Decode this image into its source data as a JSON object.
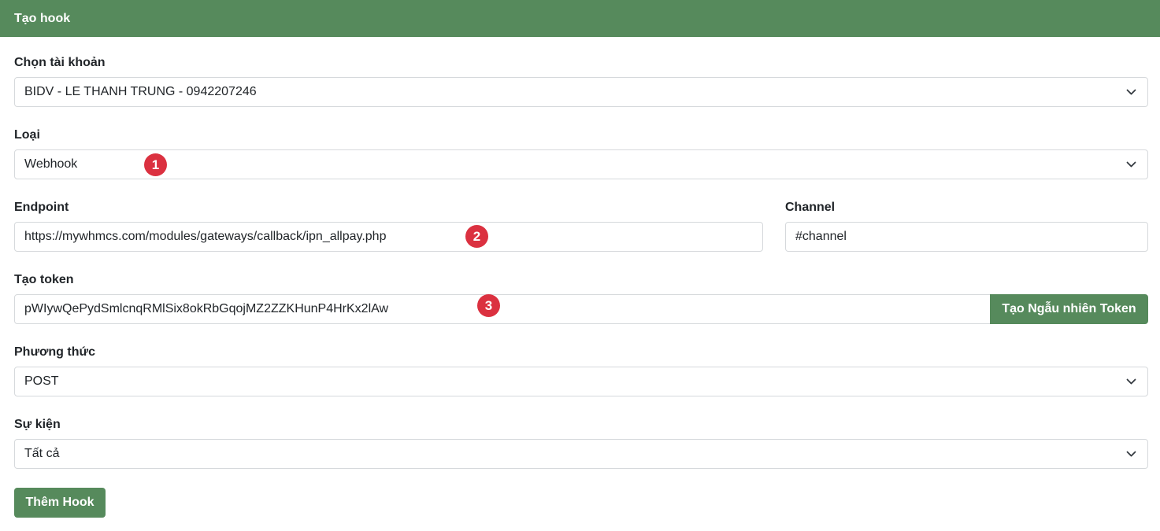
{
  "header": {
    "title": "Tạo hook"
  },
  "account": {
    "label": "Chọn tài khoản",
    "value": "BIDV - LE THANH TRUNG - 0942207246"
  },
  "type": {
    "label": "Loại",
    "value": "Webhook",
    "badge": "1"
  },
  "endpoint": {
    "label": "Endpoint",
    "value": "https://mywhmcs.com/modules/gateways/callback/ipn_allpay.php",
    "badge": "2"
  },
  "channel": {
    "label": "Channel",
    "value": "#channel"
  },
  "token": {
    "label": "Tạo token",
    "value": "pWIywQePydSmlcnqRMlSix8okRbGqojMZ2ZZKHunP4HrKx2lAw",
    "badge": "3",
    "generate_button": "Tạo Ngẫu nhiên Token"
  },
  "method": {
    "label": "Phương thức",
    "value": "POST"
  },
  "event": {
    "label": "Sự kiện",
    "value": "Tất cả"
  },
  "submit_button": "Thêm Hook",
  "colors": {
    "primary": "#568a5c",
    "badge": "#db3140",
    "border": "#d6d9dc"
  }
}
